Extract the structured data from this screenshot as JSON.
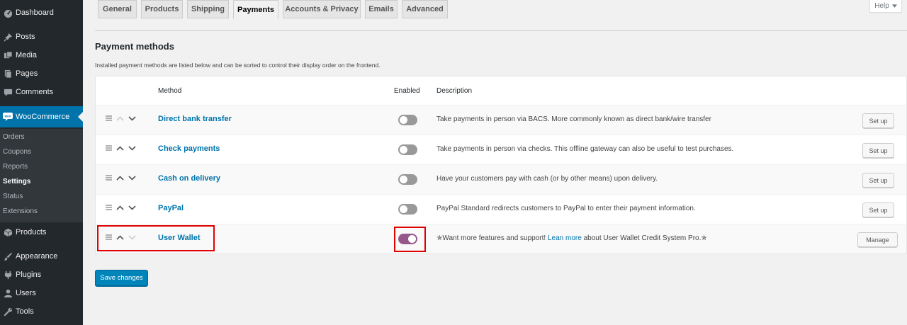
{
  "sidebar": {
    "menu": [
      {
        "label": "Dashboard",
        "icon": "dashboard-icon"
      },
      {
        "label": "Posts",
        "icon": "pin-icon"
      },
      {
        "label": "Media",
        "icon": "media-icon"
      },
      {
        "label": "Pages",
        "icon": "pages-icon"
      },
      {
        "label": "Comments",
        "icon": "comment-icon"
      },
      {
        "label": "WooCommerce",
        "icon": "woocommerce-icon"
      },
      {
        "label": "Products",
        "icon": "box-icon"
      },
      {
        "label": "Appearance",
        "icon": "brush-icon"
      },
      {
        "label": "Plugins",
        "icon": "plugin-icon"
      },
      {
        "label": "Users",
        "icon": "user-icon"
      },
      {
        "label": "Tools",
        "icon": "wrench-icon"
      }
    ],
    "submenu": [
      "Orders",
      "Coupons",
      "Reports",
      "Settings",
      "Status",
      "Extensions"
    ],
    "current_submenu": "Settings"
  },
  "help_label": "Help",
  "tabs": [
    "General",
    "Products",
    "Shipping",
    "Payments",
    "Accounts & Privacy",
    "Emails",
    "Advanced"
  ],
  "active_tab": "Payments",
  "heading": "Payment methods",
  "intro": "Installed payment methods are listed below and can be sorted to control their display order on the frontend.",
  "table": {
    "columns": {
      "method": "Method",
      "enabled": "Enabled",
      "description": "Description"
    },
    "rows": [
      {
        "name": "Direct bank transfer",
        "enabled": false,
        "description": "Take payments in person via BACS. More commonly known as direct bank/wire transfer",
        "action": "Set up"
      },
      {
        "name": "Check payments",
        "enabled": false,
        "description": "Take payments in person via checks. This offline gateway can also be useful to test purchases.",
        "action": "Set up"
      },
      {
        "name": "Cash on delivery",
        "enabled": false,
        "description": "Have your customers pay with cash (or by other means) upon delivery.",
        "action": "Set up"
      },
      {
        "name": "PayPal",
        "enabled": false,
        "description": "PayPal Standard redirects customers to PayPal to enter their payment information.",
        "action": "Set up"
      },
      {
        "name": "User Wallet",
        "enabled": true,
        "description_pre": "✯Want more features and support! ",
        "description_link": "Lean more",
        "description_post": " about User Wallet Credit System Pro.✯",
        "action": "Manage"
      }
    ]
  },
  "save_label": "Save changes",
  "colors": {
    "sidebar": "#23282d",
    "accent": "#0073aa",
    "toggle_on": "#96588a",
    "highlight": "#e00000"
  }
}
